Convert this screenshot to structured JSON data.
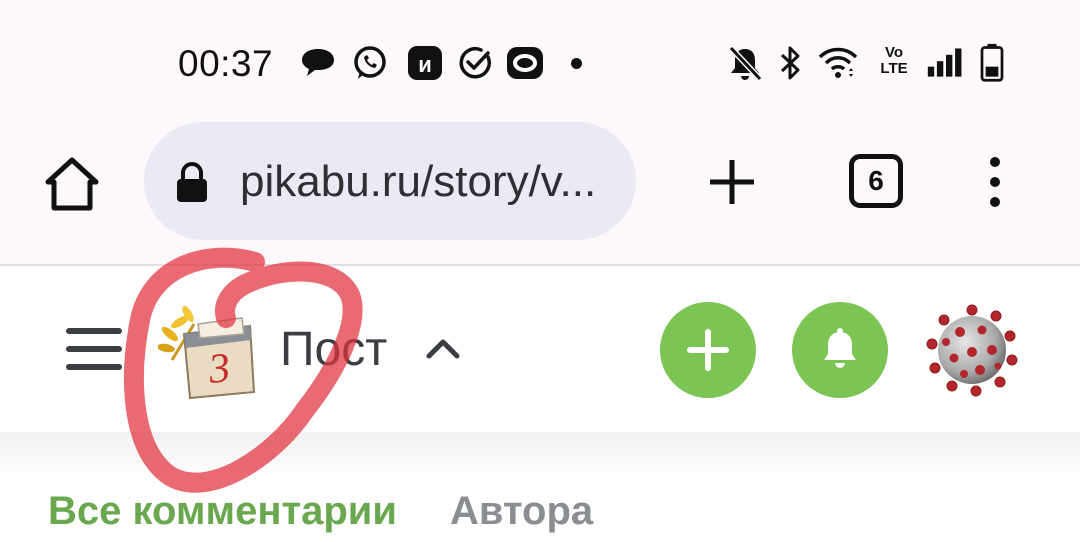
{
  "status_bar": {
    "time": "00:37",
    "left_icons": [
      "speech-bubble-icon",
      "whatsapp-icon",
      "messenger-app-icon",
      "check-circle-icon",
      "app-o-icon"
    ],
    "right_icons": [
      "bell-muted-icon",
      "bluetooth-icon",
      "wifi-icon",
      "volte-icon",
      "signal-icon",
      "battery-icon"
    ],
    "volte_label": "Vo LTE"
  },
  "browser": {
    "url": "pikabu.ru/story/v...",
    "tab_count": "6",
    "icons": [
      "home-icon",
      "lock-icon",
      "new-tab-plus-icon",
      "tabs-counter",
      "more-menu-icon"
    ]
  },
  "site_header": {
    "title": "Пост",
    "logo_calendar_letter": "3",
    "icons": [
      "hamburger-menu-icon",
      "calendar-logo",
      "chevron-up-icon",
      "add-post-button",
      "notifications-button",
      "user-avatar"
    ]
  },
  "tabs": {
    "all_comments": "Все комментарии",
    "author": "Автора"
  },
  "colors": {
    "accent_green": "#7cc453",
    "active_tab": "#6aa84f",
    "inactive_tab": "#8a8d92",
    "annotation_red": "#e0313b",
    "url_bar_bg": "#ebe9f3"
  }
}
